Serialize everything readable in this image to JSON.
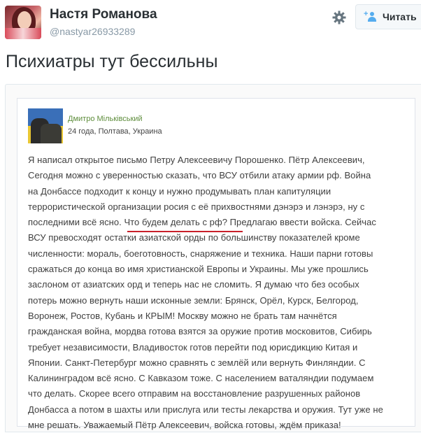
{
  "header": {
    "user_name": "Настя Романова",
    "user_handle": "@nastyar26933289",
    "follow_label": "Читать",
    "settings_icon": "gear-icon",
    "follow_icon": "add-user-icon"
  },
  "tweet": {
    "text": "Психиатры тут бессильны"
  },
  "embedded_post": {
    "author_name": "Дмитро Мільківський",
    "author_meta": "24 года, Полтава, Украина",
    "lines": [
      "Я написал открытое письмо Петру Алексеевичу Порошенко. Пётр Алексеевич,",
      "Сегодня можно с уверенностью сказать, что ВСУ отбили атаку армии рф. Война",
      "на Донбассе подходит к концу и нужно продумывать план капитуляции",
      "террористической организации росия с её прихвостнями дэнэрэ и лэнэрэ, ну с",
      "последними всё ясно. Что будем делать с рф? Предлагаю ввести войска. Сейчас",
      "ВСУ превосходят остатки азиатской орды по большинству показателей кроме",
      "численности: мораль, боеготовность, снаряжение и техника. Наши парни готовы",
      "сражаться до конца во имя христианской Европы и Украины. Мы уже прошлись",
      "заслоном от азиатских орд и теперь нас не сломить. Я думаю что без особых",
      "потерь можно вернуть наши исконные земли: Брянск, Орёл, Курск, Белгород,",
      "Воронеж, Ростов, Кубань и КРЫМ! Москву можно не брать там начнётся",
      "гражданская война, мордва готова взятся за оружие против московитов, Сибирь",
      "требует независимости, Владивосток готов перейти под юрисдикцию Китая и",
      "Японии. Санкт-Петербург можно сравнять с землёй или вернуть Финляндии. С",
      "Калининградом всё ясно. С Кавказом тоже. С населением ваталяндии подумаем",
      "что делать. Скорее всего отправим на восстановление разрушенных районов",
      "Донбасса а потом в шахты или прислуга или тесты лекарства и оружия. Тут уже не",
      "мне решать. Уважаемый Пётр Алексеевич, войска готовы, ждём приказа!"
    ]
  }
}
